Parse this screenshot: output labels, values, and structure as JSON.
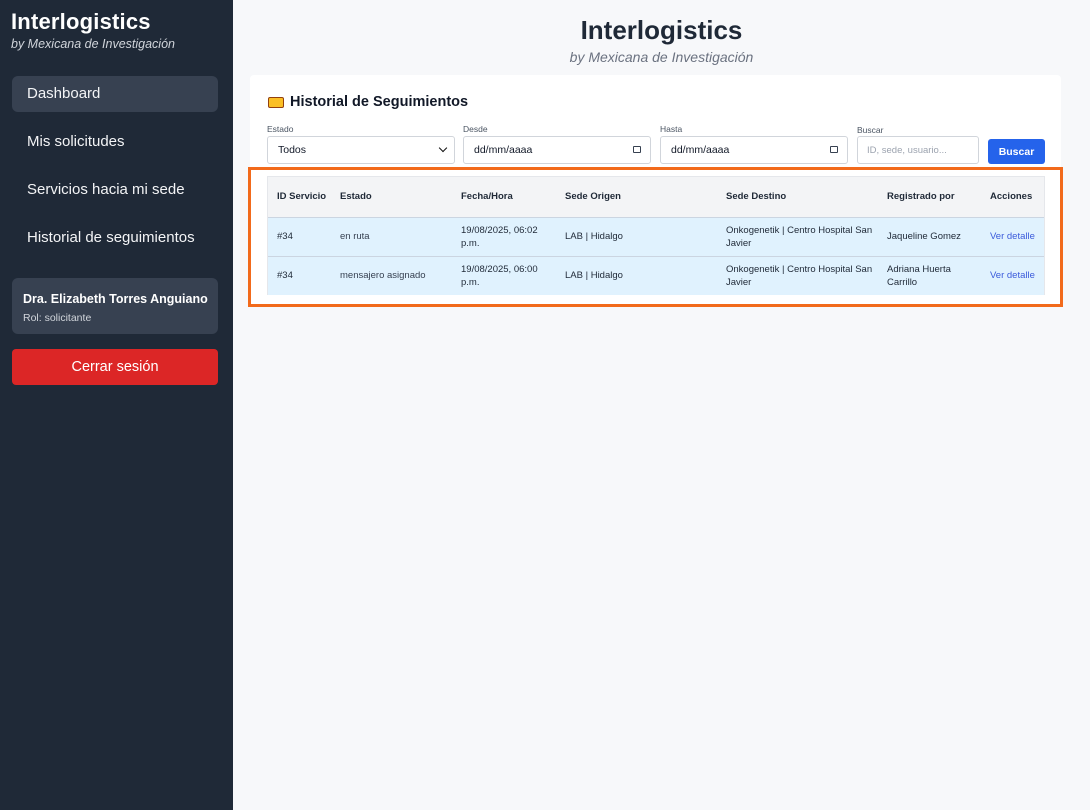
{
  "sidebar": {
    "brand_title": "Interlogistics",
    "brand_subtitle": "by Mexicana de Investigación",
    "nav": [
      {
        "label": "Dashboard",
        "active": true
      },
      {
        "label": "Mis solicitudes",
        "active": false
      },
      {
        "label": "Servicios hacia mi sede",
        "active": false
      },
      {
        "label": "Historial de seguimientos",
        "active": false
      }
    ],
    "user": {
      "name": "Dra. Elizabeth Torres Anguiano",
      "role": "Rol: solicitante"
    },
    "logout_label": "Cerrar sesión"
  },
  "header": {
    "title": "Interlogistics",
    "subtitle": "by Mexicana de Investigación"
  },
  "panel": {
    "title": "Historial de Seguimientos",
    "filters": {
      "estado_label": "Estado",
      "estado_value": "Todos",
      "desde_label": "Desde",
      "desde_value": "dd/mm/aaaa",
      "hasta_label": "Hasta",
      "hasta_value": "dd/mm/aaaa",
      "buscar_label": "Buscar",
      "buscar_placeholder": "ID, sede, usuario...",
      "buscar_button": "Buscar"
    },
    "table": {
      "headers": [
        "ID Servicio",
        "Estado",
        "Fecha/Hora",
        "Sede Origen",
        "Sede Destino",
        "Registrado por",
        "Acciones"
      ],
      "rows": [
        {
          "id": "#34",
          "estado": "en ruta",
          "fecha": "19/08/2025, 06:02 p.m.",
          "origen": "LAB | Hidalgo",
          "destino": "Onkogenetik | Centro Hospital San Javier",
          "registrado": "Jaqueline Gomez",
          "accion": "Ver detalle"
        },
        {
          "id": "#34",
          "estado": "mensajero asignado",
          "fecha": "19/08/2025, 06:00 p.m.",
          "origen": "LAB | Hidalgo",
          "destino": "Onkogenetik | Centro Hospital San Javier",
          "registrado": "Adriana Huerta Carrillo",
          "accion": "Ver detalle"
        }
      ]
    }
  },
  "colors": {
    "sidebar": "#1f2937",
    "accent": "#2563eb",
    "logout": "#dc2626",
    "highlight": "#f26a1b",
    "row": "#e0f2fe"
  }
}
